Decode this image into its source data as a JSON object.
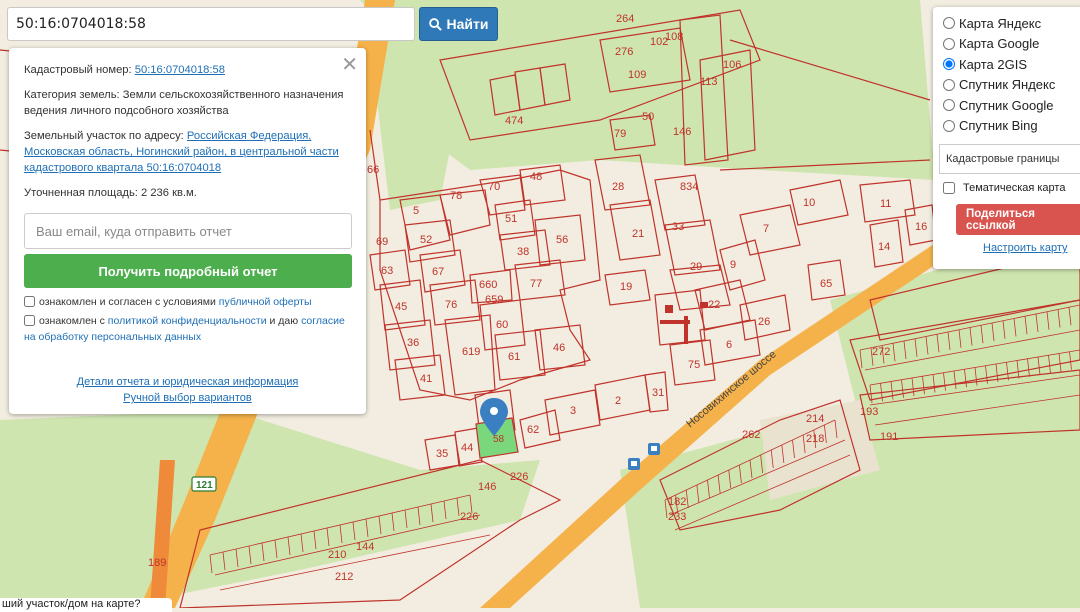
{
  "search": {
    "value": "50:16:0704018:58",
    "button_label": "Найти"
  },
  "info": {
    "cadastral_label": "Кадастровый номер: ",
    "cadastral_number": "50:16:0704018:58",
    "category_text": "Категория земель: Земли сельскохозяйственного назначения ведения личного подсобного хозяйства",
    "address_label": "Земельный участок по адресу: ",
    "address_link": "Российская Федерация, Московская область, Ногинский район, в центральной части кадастрового квартала 50:16:0704018",
    "area_text": "Уточненная площадь: 2 236 кв.м.",
    "email_placeholder": "Ваш email, куда отправить отчет",
    "report_button": "Получить подробный отчет",
    "consent1_text": "ознакомлен и согласен с условиями ",
    "consent1_link": "публичной оферты",
    "consent2_text1": "ознакомлен с ",
    "consent2_link1": "политикой конфиденциальности",
    "consent2_text2": " и даю ",
    "consent2_link2": "согласие на обработку персональных данных",
    "details_link": "Детали отчета и юридическая информация",
    "manual_link": "Ручной выбор вариантов"
  },
  "layers": {
    "options": [
      {
        "label": "Карта Яндекс",
        "checked": false
      },
      {
        "label": "Карта Google",
        "checked": false
      },
      {
        "label": "Карта 2GIS",
        "checked": true
      },
      {
        "label": "Спутник Яндекс",
        "checked": false
      },
      {
        "label": "Спутник Google",
        "checked": false
      },
      {
        "label": "Спутник Bing",
        "checked": false
      }
    ],
    "cadastral_select": "Кадастровые границы",
    "thematic_label": "Тематическая карта",
    "share_button": "Поделиться ссылкой",
    "setup_link": "Настроить карту"
  },
  "map": {
    "road_label": "Носовихинское шоссе",
    "route_number": "121",
    "selected_parcel": "58",
    "parcel_numbers": [
      "5",
      "78",
      "70",
      "48",
      "52",
      "51",
      "56",
      "67",
      "38",
      "63",
      "77",
      "45",
      "76",
      "660",
      "659",
      "60",
      "36",
      "619",
      "61",
      "46",
      "41",
      "3",
      "2",
      "62",
      "35",
      "44",
      "28",
      "834",
      "33",
      "21",
      "29",
      "9",
      "7",
      "10",
      "11",
      "14",
      "16",
      "22",
      "26",
      "19",
      "6",
      "75",
      "31",
      "65",
      "262",
      "226",
      "214",
      "218",
      "182",
      "233",
      "146",
      "226",
      "210",
      "144",
      "212",
      "189",
      "272",
      "193",
      "191",
      "276",
      "102",
      "108",
      "106",
      "109",
      "113",
      "474",
      "79",
      "50",
      "146",
      "69",
      "66",
      "264",
      "5/3",
      "30"
    ],
    "colors": {
      "bg": "#f2ede0",
      "green": "#cfe5b0",
      "parcel": "#c0332b",
      "selected": "#7bd77b",
      "road": "#f6b24a"
    }
  },
  "bottom_tip": "ший участок/дом на карте?"
}
